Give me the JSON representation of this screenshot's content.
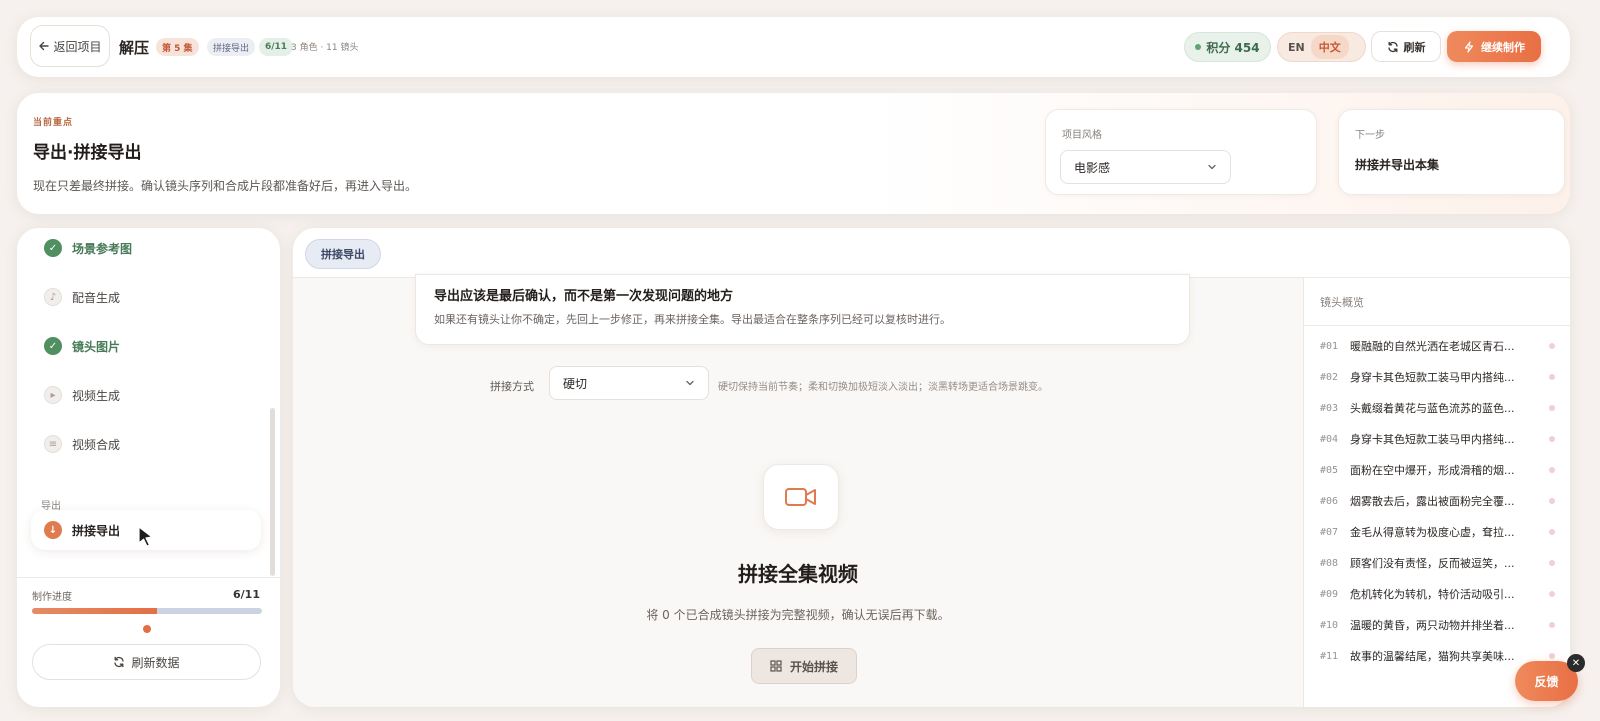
{
  "header": {
    "back_label": "返回项目",
    "project_title": "解压",
    "episode_tag": "第 5 集",
    "stage_tag": "拼接导出",
    "progress_tag": "6/11",
    "meta": "3 角色 · 11 镜头",
    "points_label": "积分 454",
    "lang_en": "EN",
    "lang_zh": "中文",
    "refresh_label": "刷新",
    "continue_label": "继续制作"
  },
  "focus": {
    "label": "当前重点",
    "title": "导出·拼接导出",
    "description": "现在只差最终拼接。确认镜头序列和合成片段都准备好后，再进入导出。",
    "style_label": "项目风格",
    "style_value": "电影感",
    "next_label": "下一步",
    "next_value": "拼接并导出本集"
  },
  "sidebar": {
    "steps": [
      {
        "label": "场景参考图",
        "state": "done"
      },
      {
        "label": "配音生成",
        "state": "idle"
      },
      {
        "label": "镜头图片",
        "state": "done"
      },
      {
        "label": "视频生成",
        "state": "idle"
      },
      {
        "label": "视频合成",
        "state": "idle"
      }
    ],
    "section_label": "导出",
    "active_step": "拼接导出",
    "progress_label": "制作进度",
    "progress_count": "6/11",
    "progress_fraction": 0.545,
    "refresh_data_label": "刷新数据"
  },
  "main": {
    "tab_label": "拼接导出",
    "warning_title": "导出应该是最后确认，而不是第一次发现问题的地方",
    "warning_desc": "如果还有镜头让你不确定，先回上一步修正，再来拼接全集。导出最适合在整条序列已经可以复核时进行。",
    "mode_label": "拼接方式",
    "mode_value": "硬切",
    "mode_hint": "硬切保持当前节奏；柔和切换加极短淡入淡出；淡黑转场更适合场景跳变。",
    "empty_title": "拼接全集视频",
    "empty_desc": "将 0 个已合成镜头拼接为完整视频，确认无误后再下载。",
    "start_label": "开始拼接"
  },
  "overview": {
    "title": "镜头概览",
    "shots": [
      {
        "no": "#01",
        "text": "暖融融的自然光洒在老城区青石..."
      },
      {
        "no": "#02",
        "text": "身穿卡其色短款工装马甲内搭纯..."
      },
      {
        "no": "#03",
        "text": "头戴缀着黄花与蓝色流苏的蓝色..."
      },
      {
        "no": "#04",
        "text": "身穿卡其色短款工装马甲内搭纯..."
      },
      {
        "no": "#05",
        "text": "面粉在空中爆开，形成滑稽的烟..."
      },
      {
        "no": "#06",
        "text": "烟雾散去后，露出被面粉完全覆..."
      },
      {
        "no": "#07",
        "text": "金毛从得意转为极度心虚，耷拉..."
      },
      {
        "no": "#08",
        "text": "顾客们没有责怪，反而被逗笑，..."
      },
      {
        "no": "#09",
        "text": "危机转化为转机，特价活动吸引..."
      },
      {
        "no": "#10",
        "text": "温暖的黄昏，两只动物并排坐着..."
      },
      {
        "no": "#11",
        "text": "故事的温馨结尾，猫狗共享美味..."
      }
    ]
  },
  "feedback_label": "反馈",
  "colors": {
    "accent": "#e86f44",
    "success": "#4f8f60",
    "background": "#f6f1ee"
  }
}
